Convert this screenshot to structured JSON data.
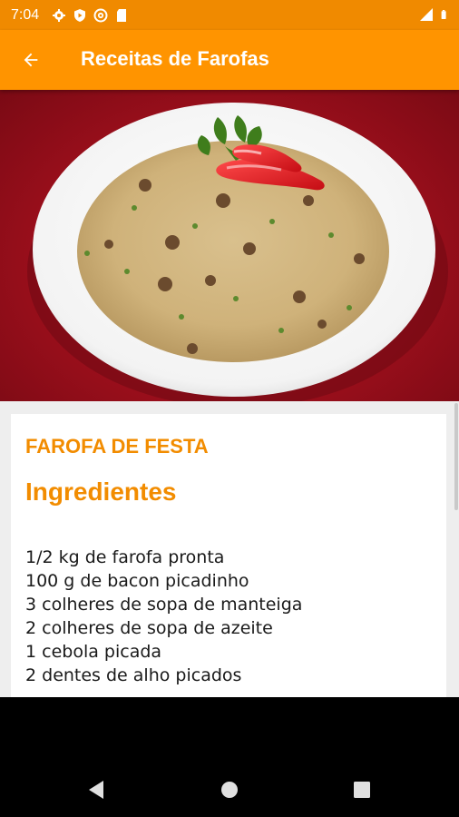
{
  "status_bar": {
    "time": "7:04",
    "left_icons": [
      "gear-icon",
      "shield-icon",
      "at-icon",
      "sd-card-icon"
    ],
    "right_icons": [
      "signal-icon",
      "battery-icon"
    ]
  },
  "app_bar": {
    "title": "Receitas de Farofas",
    "back_icon": "arrow-back-icon"
  },
  "colors": {
    "app_bar": "#ff9400",
    "status_bar": "#f08a00",
    "accent_text": "#f28c00"
  },
  "recipe": {
    "image": "farofa-dish-photo",
    "title": "FAROFA DE FESTA",
    "section_heading": "Ingredientes",
    "ingredients": [
      "1/2 kg de farofa pronta",
      "100 g de bacon picadinho",
      "3 colheres de sopa de manteiga",
      "2 colheres de sopa de azeite",
      "1 cebola picada",
      "2 dentes de alho picados"
    ]
  },
  "nav_bar": {
    "buttons": [
      "back-triangle-icon",
      "home-circle-icon",
      "recents-square-icon"
    ]
  }
}
